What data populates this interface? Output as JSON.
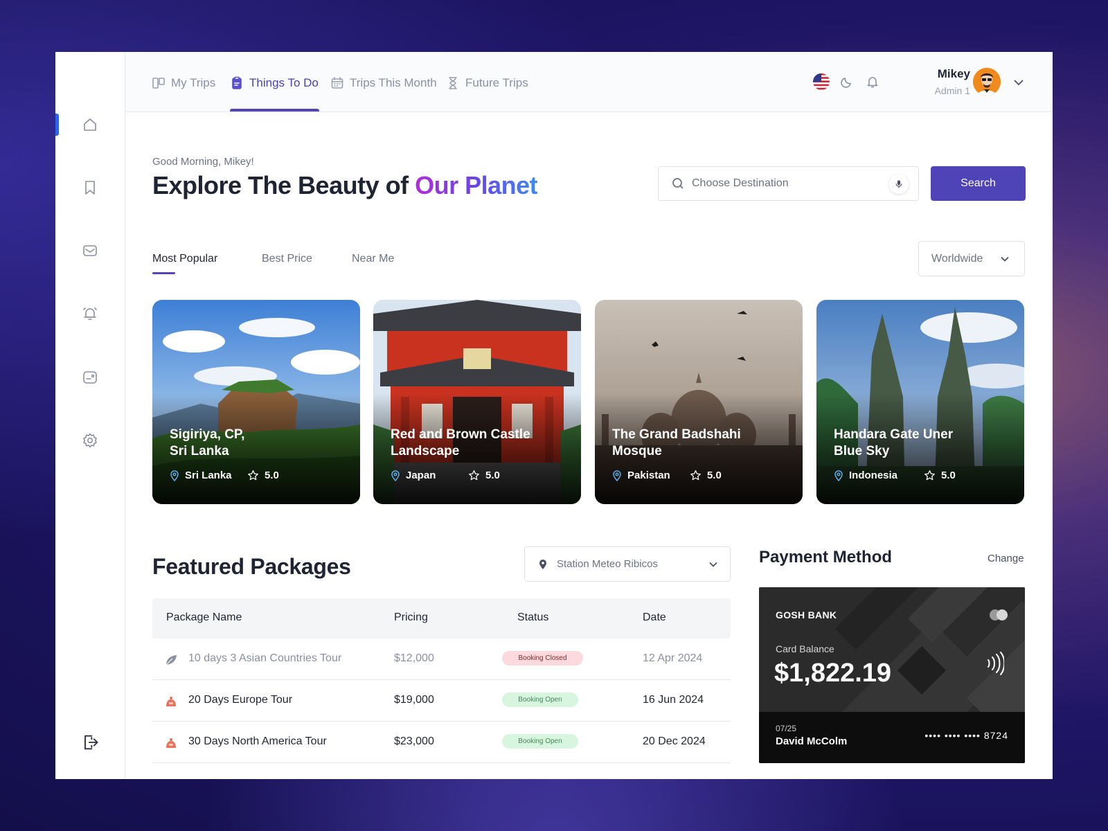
{
  "nav": {
    "tabs": [
      {
        "label": "My Trips",
        "icon": "columns-icon"
      },
      {
        "label": "Things To Do",
        "icon": "clipboard-icon"
      },
      {
        "label": "Trips This Month",
        "icon": "calendar-icon"
      },
      {
        "label": "Future Trips",
        "icon": "hourglass-icon"
      }
    ],
    "active_tab": "Things To Do"
  },
  "user": {
    "name": "Mikey",
    "role": "Admin 1"
  },
  "sidebar": {
    "items": [
      "home-icon",
      "bookmark-icon",
      "mail-icon",
      "alarm-icon",
      "ticket-icon",
      "settings-icon"
    ],
    "bottom": "logout-icon"
  },
  "header": {
    "greeting": "Good Morning, Mikey!",
    "title_plain": "Explore The Beauty of ",
    "title_accent": "Our Planet"
  },
  "search": {
    "placeholder": "Choose Destination",
    "button": "Search"
  },
  "filters": {
    "tabs": [
      "Most Popular",
      "Best Price",
      "Near Me"
    ],
    "active": "Most Popular",
    "region": "Worldwide"
  },
  "destinations": [
    {
      "title_line1": "Sigiriya, CP,",
      "title_line2": "Sri Lanka",
      "location": "Sri Lanka",
      "rating": "5.0"
    },
    {
      "title_line1": "Red and Brown Castle",
      "title_line2": "Landscape",
      "location": "Japan",
      "rating": "5.0"
    },
    {
      "title_line1": "The Grand Badshahi",
      "title_line2": "Mosque",
      "location": "Pakistan",
      "rating": "5.0"
    },
    {
      "title_line1": "Handara Gate Uner",
      "title_line2": "Blue Sky",
      "location": "Indonesia",
      "rating": "5.0"
    }
  ],
  "featured": {
    "title": "Featured Packages",
    "station": "Station Meteo Ribicos",
    "columns": [
      "Package Name",
      "Pricing",
      "Status",
      "Date"
    ],
    "rows": [
      {
        "name": "10 days 3 Asian Countries Tour",
        "price": "$12,000",
        "status": "Booking Closed",
        "date": "12 Apr 2024"
      },
      {
        "name": "20 Days Europe Tour",
        "price": "$19,000",
        "status": "Booking Open",
        "date": "16 Jun 2024"
      },
      {
        "name": "30 Days North America Tour",
        "price": "$23,000",
        "status": "Booking Open",
        "date": "20 Dec 2024"
      }
    ]
  },
  "payment": {
    "title": "Payment Method",
    "change": "Change",
    "bank": "GOSH BANK",
    "balance_label": "Card Balance",
    "balance": "$1,822.19",
    "expiry": "07/25",
    "holder": "David McColm",
    "number": "•••• •••• •••• 8724"
  },
  "colors": {
    "accent": "#4f44b7",
    "active_bar": "#2f62e8",
    "open_badge": "#d8f6df",
    "closed_badge": "#fcd9dc"
  }
}
